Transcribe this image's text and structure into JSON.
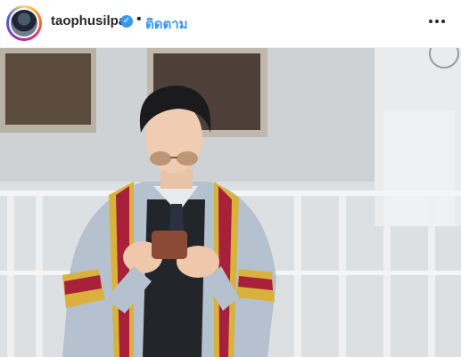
{
  "post": {
    "username": "taophusilpa",
    "verified_mark": "✓",
    "separator": "•",
    "follow_label": "ติดตาม",
    "more_icon": "more-horizontal-icon",
    "verified_color": "#3897f0",
    "follow_color": "#3897f0"
  },
  "photo": {
    "description_icon": "post-photo"
  }
}
